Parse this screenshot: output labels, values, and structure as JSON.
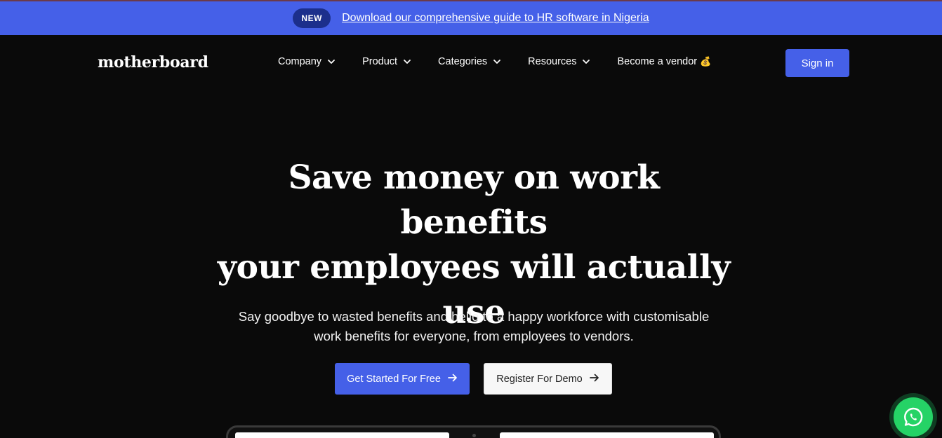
{
  "announcement": {
    "badge": "NEW",
    "link_text": "Download our comprehensive guide to HR software in Nigeria"
  },
  "nav": {
    "logo": "motherboard",
    "menu": [
      {
        "label": "Company",
        "icon": "chevron-down-icon"
      },
      {
        "label": "Product",
        "icon": "chevron-down-icon"
      },
      {
        "label": "Categories",
        "icon": "chevron-down-icon"
      },
      {
        "label": "Resources",
        "icon": "chevron-down-icon"
      }
    ],
    "vendor": {
      "label": "Become a vendor",
      "icon": "💰"
    },
    "signin": "Sign in"
  },
  "hero": {
    "title_lines": [
      "Save money on work benefits",
      "your employees will actually",
      "use"
    ],
    "subtitle_lines": [
      "Say goodbye to wasted benefits and hello to a happy workforce with customisable",
      "work benefits for everyone, from employees to vendors."
    ],
    "primary_cta": "Get Started For Free",
    "secondary_cta": "Register For Demo"
  },
  "colors": {
    "accent": "#4560e8",
    "background": "#0a0a0a",
    "whatsapp": "#25d366"
  }
}
